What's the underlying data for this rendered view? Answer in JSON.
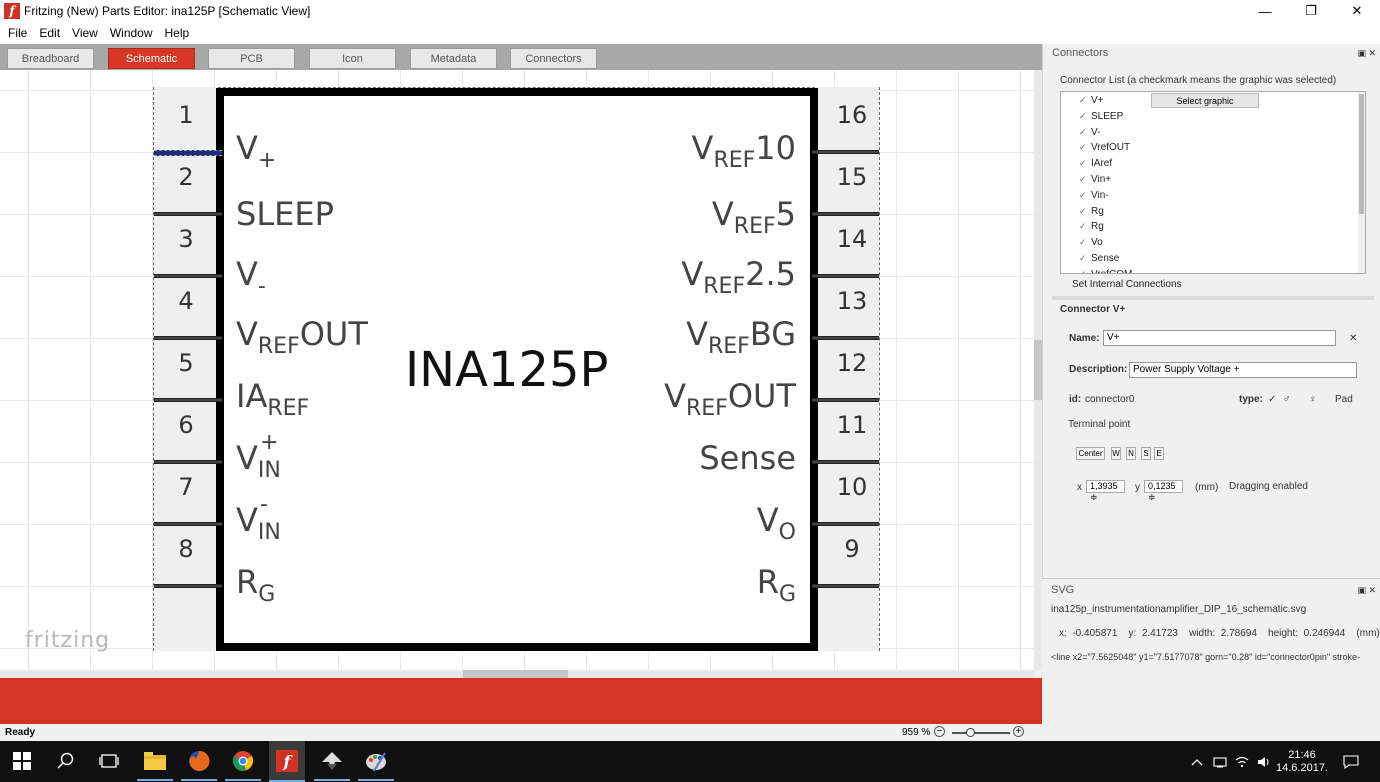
{
  "window": {
    "title": "Fritzing (New) Parts Editor: ina125P [Schematic View]",
    "minimize": "—",
    "maximize": "❐",
    "close": "✕"
  },
  "menu": [
    "File",
    "Edit",
    "View",
    "Window",
    "Help"
  ],
  "tabs": [
    "Breadboard",
    "Schematic",
    "PCB",
    "Icon",
    "Metadata",
    "Connectors"
  ],
  "active_tab": "Schematic",
  "schematic": {
    "title": "INA125P",
    "left_pins": [
      {
        "num": "1",
        "main": "V",
        "sub": "+",
        "sup": ""
      },
      {
        "num": "2",
        "main": "SLEEP",
        "sub": "",
        "sup": ""
      },
      {
        "num": "3",
        "main": "V",
        "sub": "-",
        "sup": ""
      },
      {
        "num": "4",
        "main": "V",
        "sub": "REF",
        "after": "OUT",
        "sup": ""
      },
      {
        "num": "5",
        "main": "IA",
        "sub": "REF",
        "sup": ""
      },
      {
        "num": "6",
        "main": "V",
        "sub": "IN",
        "sup": "+"
      },
      {
        "num": "7",
        "main": "V",
        "sub": "IN",
        "sup": "-"
      },
      {
        "num": "8",
        "main": "R",
        "sub": "G",
        "sup": ""
      }
    ],
    "right_pins": [
      {
        "num": "16",
        "main": "V",
        "sub": "REF",
        "after": "10"
      },
      {
        "num": "15",
        "main": "V",
        "sub": "REF",
        "after": "5"
      },
      {
        "num": "14",
        "main": "V",
        "sub": "REF",
        "after": "2.5"
      },
      {
        "num": "13",
        "main": "V",
        "sub": "REF",
        "after": "BG"
      },
      {
        "num": "12",
        "main": "V",
        "sub": "REF",
        "after": "OUT"
      },
      {
        "num": "11",
        "main": "Sense",
        "sub": "",
        "after": ""
      },
      {
        "num": "10",
        "main": "V",
        "sub": "O",
        "after": ""
      },
      {
        "num": "9",
        "main": "R",
        "sub": "G",
        "after": ""
      }
    ]
  },
  "watermark": "fritzing",
  "status": {
    "ready": "Ready",
    "zoom": "959 %",
    "zoom_minus": "−",
    "zoom_plus": "+"
  },
  "connectors_panel": {
    "title": "Connectors",
    "list_label": "Connector List (a checkmark means the graphic was selected)",
    "items": [
      "V+",
      "SLEEP",
      "V-",
      "VrefOUT",
      "IAref",
      "Vin+",
      "Vin-",
      "Rg",
      "Rg",
      "Vo",
      "Sense",
      "VrefCOM"
    ],
    "check": "✓",
    "select_graphic": "Select graphic",
    "set_internal": "Set Internal Connections",
    "connector_header": "Connector V+",
    "name_label": "Name:",
    "name_value": "V+",
    "clear": "✕",
    "description_label": "Description:",
    "description_value": "Power Supply Voltage +",
    "id_label": "id:",
    "id_value": "connector0",
    "type_label": "type:",
    "type_options": [
      "✓",
      "♂",
      "♀",
      "Pad"
    ],
    "terminal_label": "Terminal point",
    "terminal_buttons": [
      "Center",
      "W",
      "N",
      "S",
      "E"
    ],
    "x_label": "x",
    "x_value": "1,3935 ≑",
    "y_label": "y",
    "y_value": "0,1235 ≑",
    "unit": "(mm)",
    "dragging": "Dragging enabled"
  },
  "svg_panel": {
    "title": "SVG",
    "filename": "ina125p_instrumentationamplifier_DIP_16_schematic.svg",
    "geometry_line": "x:  -0.405871    y:  2.41723    width:  2.78694    height:  0.246944    (mm)",
    "element_line": "<line  x2=\"7.5625048\" y1=\"7.5177078\" gorn=\"0.28\" id=\"connector0pin\" stroke-"
  },
  "panel_ctl": "▣ ✕",
  "taskbar": {
    "time": "21:46",
    "date": "14.6.2017."
  }
}
